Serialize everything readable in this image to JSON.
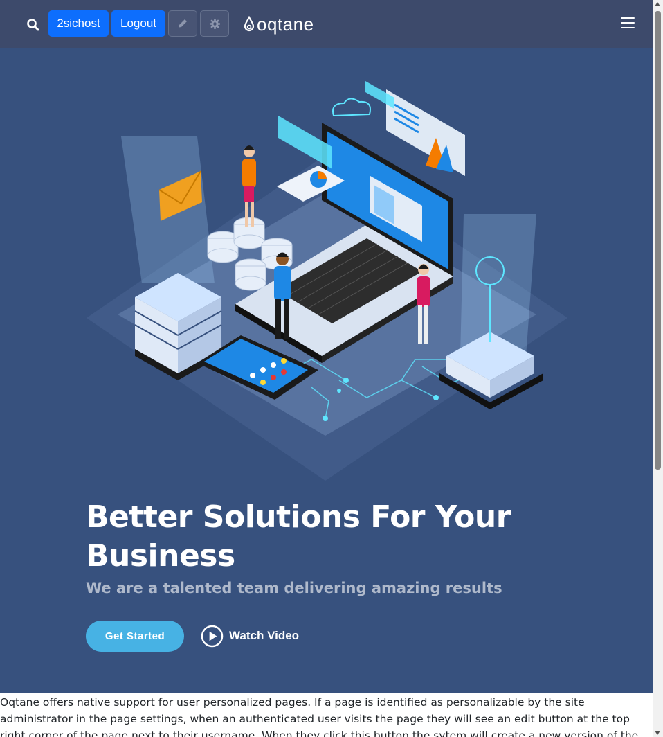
{
  "navbar": {
    "username_label": "2sichost",
    "logout_label": "Logout",
    "logo_text": "oqtane",
    "icons": [
      "search-icon",
      "pencil-icon",
      "gear-icon",
      "oqtane-drop-icon",
      "hamburger-icon"
    ]
  },
  "hero": {
    "title": "Better Solutions For Your Business",
    "subtitle": "We are a talented team delivering amazing results",
    "get_started_label": "Get Started",
    "watch_video_label": "Watch Video",
    "background_color": "#37517e",
    "accent_color": "#47b2e4"
  },
  "content": {
    "paragraph": "Oqtane offers native support for user personalized pages. If a page is identified as personalizable by the site administrator in the page settings, when an authenticated user visits the page they will see an edit button at the top right corner of the page next to their username. When they click this button the sytem will create a new version of the page and allow them to edit the"
  }
}
